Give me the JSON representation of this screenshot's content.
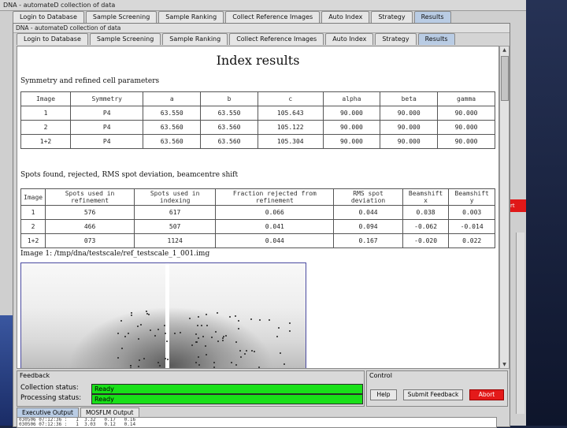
{
  "bg_window": {
    "title": "DNA - automateD collection of data",
    "tabs": [
      "Login to Database",
      "Sample Screening",
      "Sample Ranking",
      "Collect Reference Images",
      "Auto Index",
      "Strategy",
      "Results"
    ],
    "active_tab": 6,
    "abort_label": "rt"
  },
  "window": {
    "title": "DNA - automateD collection of data",
    "tabs": [
      "Login to Database",
      "Sample Screening",
      "Sample Ranking",
      "Collect Reference Images",
      "Auto Index",
      "Strategy",
      "Results"
    ],
    "active_tab": 6
  },
  "report": {
    "heading": "Index results",
    "cell_section": "Symmetry and refined cell parameters",
    "cell_headers": [
      "Image",
      "Symmetry",
      "a",
      "b",
      "c",
      "alpha",
      "beta",
      "gamma"
    ],
    "cell_rows": [
      [
        "1",
        "P4",
        "63.550",
        "63.550",
        "105.643",
        "90.000",
        "90.000",
        "90.000"
      ],
      [
        "2",
        "P4",
        "63.560",
        "63.560",
        "105.122",
        "90.000",
        "90.000",
        "90.000"
      ],
      [
        "1+2",
        "P4",
        "63.560",
        "63.560",
        "105.304",
        "90.000",
        "90.000",
        "90.000"
      ]
    ],
    "spots_section": "Spots found, rejected, RMS spot deviation, beamcentre shift",
    "spots_headers": [
      "Image",
      "Spots used in refinement",
      "Spots used in indexing",
      "Fraction rejected from refinement",
      "RMS spot deviation",
      "Beamshift x",
      "Beamshift y"
    ],
    "spots_rows": [
      [
        "1",
        "576",
        "617",
        "0.066",
        "0.044",
        "0.038",
        "0.003"
      ],
      [
        "2",
        "466",
        "507",
        "0.041",
        "0.094",
        "-0.062",
        "-0.014"
      ],
      [
        "1+2",
        "073",
        "1124",
        "0.044",
        "0.167",
        "-0.020",
        "0.022"
      ]
    ],
    "image_caption": "Image 1: /tmp/dna/testscale/ref_testscale_1_001.img"
  },
  "feedback": {
    "label": "Feedback",
    "collection_label": "Collection status:",
    "collection_value": "Ready",
    "processing_label": "Processing status:",
    "processing_value": "Ready"
  },
  "control": {
    "label": "Control",
    "help": "Help",
    "submit": "Submit Feedback",
    "abort": "Abort"
  },
  "output": {
    "tabs": [
      "Executive Output",
      "MOSFLM Output"
    ],
    "active_tab": 0,
    "lines": "030506 07:12:36 :   1  3.32   0.17   0.16\n030506 07:12:36 :   1  3.03   0.12   0.14"
  },
  "colors": {
    "status_ok": "#19e019",
    "abort": "#e41a1a",
    "active_tab": "#b9cce4"
  }
}
